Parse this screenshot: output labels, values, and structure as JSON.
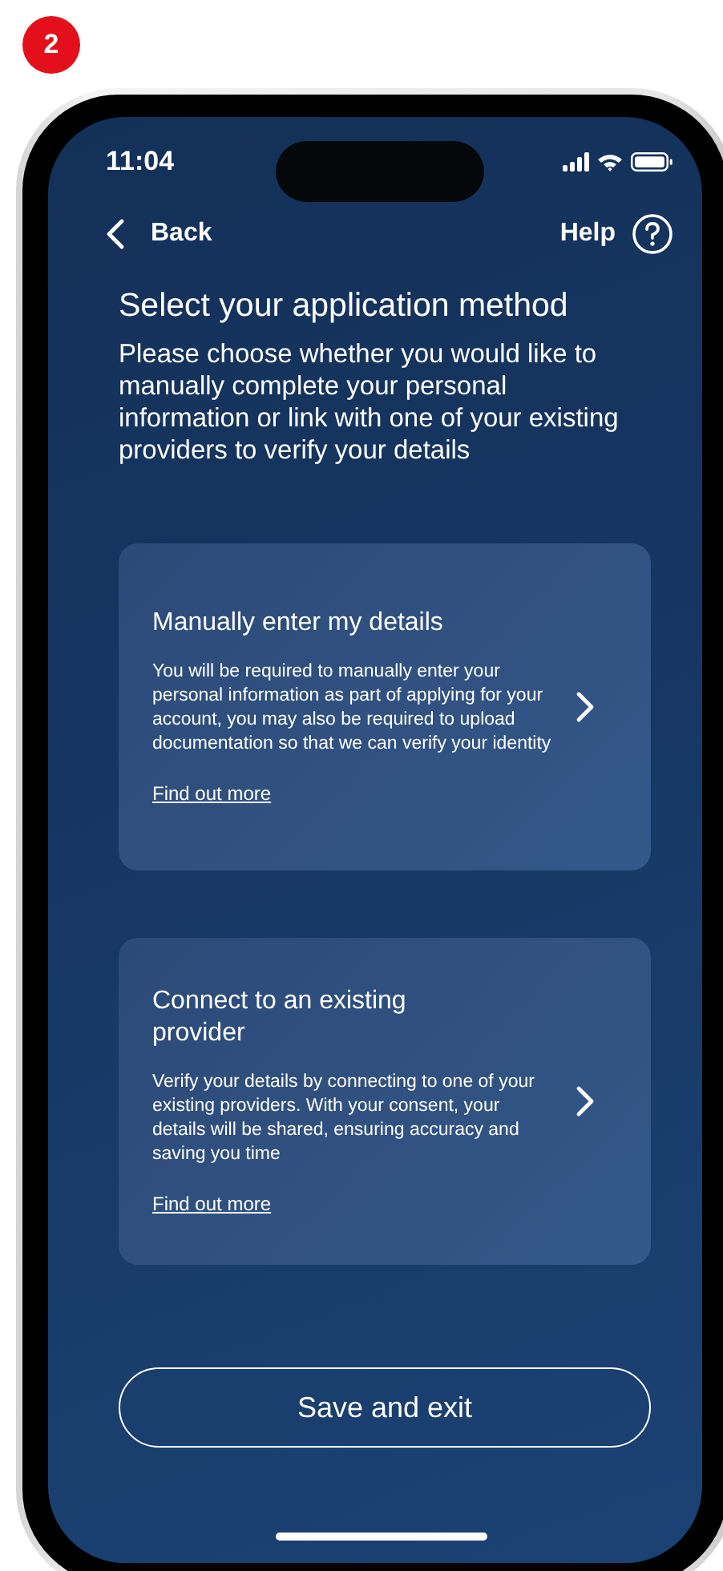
{
  "step_badge": "2",
  "status_bar": {
    "time": "11:04"
  },
  "nav": {
    "back": "Back",
    "help": "Help"
  },
  "title": "Select your application method",
  "intro": "Please choose whether you would like to manually complete your personal information or link with one of your existing providers to verify your details",
  "options": [
    {
      "title": "Manually enter my details",
      "description": "You will be required to manually enter your personal information as part of applying for your account, you may also be required to upload documentation so that we can verify your identity",
      "link": "Find out more"
    },
    {
      "title": "Connect to an existing provider",
      "description": "Verify your details by connecting to one of your existing providers. With your consent, your details will be shared, ensuring accuracy and saving you time",
      "link": "Find out more"
    }
  ],
  "save_button": "Save and exit"
}
